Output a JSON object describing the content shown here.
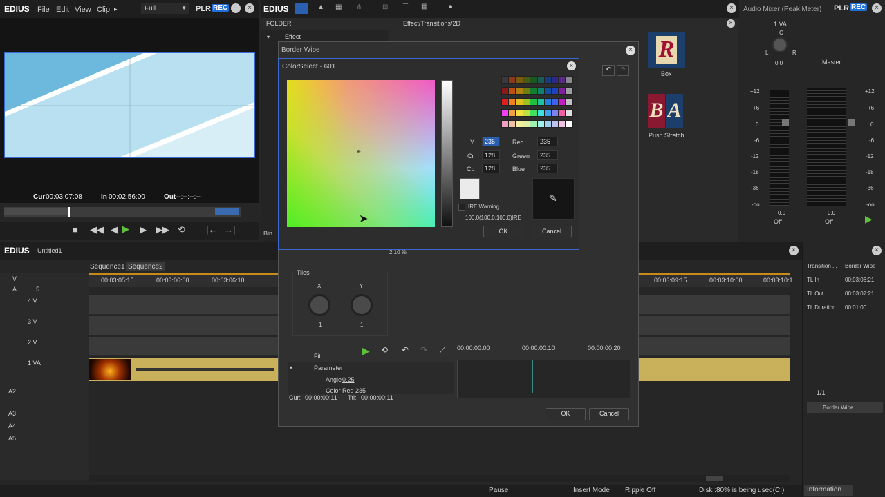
{
  "top_left": {
    "app": "EDIUS",
    "menus": [
      "File",
      "Edit",
      "View",
      "Clip"
    ],
    "quality": "Full",
    "plr": "PLR",
    "rec": "REC"
  },
  "top_mid": {
    "app": "EDIUS",
    "plr": "PLR",
    "rec": "REC"
  },
  "folder_panel": {
    "title": "FOLDER",
    "item": "Effect",
    "path": "Effect/Transitions/2D",
    "bin_label": "Bin"
  },
  "player": {
    "cur_label": "Cur",
    "cur": "00:03:07:08",
    "in_label": "In",
    "in": "00:02:56:00",
    "out_label": "Out",
    "out": "--:--:--:--"
  },
  "effects": [
    {
      "name": "Box"
    },
    {
      "name": "Push Stretch"
    }
  ],
  "mixer": {
    "title": "Audio Mixer (Peak Meter)",
    "channel": "1 VA",
    "master": "Master",
    "pan_c": "C",
    "pan_l": "L",
    "pan_r": "R",
    "val0": "0.0",
    "val_ch": "0.0",
    "val_master": "0.0",
    "off1": "Off",
    "off2": "Off",
    "scale": [
      "+12",
      "+6",
      "0",
      "-6",
      "-12",
      "-18",
      "-36",
      "-oo"
    ],
    "plr": "PLR",
    "rec": "REC"
  },
  "timeline": {
    "app": "EDIUS",
    "project": "Untitled1",
    "seq1": "Sequence1",
    "seq2": "Sequence2",
    "times": [
      "00:03:05:15",
      "00:03:06:00",
      "00:03:06:10",
      "00:03:09:15",
      "00:03:10:00",
      "00:03:10:1"
    ],
    "tracks": [
      "V",
      "A",
      "4 V",
      "3 V",
      "2 V",
      "1 VA"
    ],
    "a5": "5 ...",
    "audio_tracks": [
      "A2",
      "A3",
      "A4",
      "A5"
    ]
  },
  "info_panel": {
    "rows": [
      {
        "k": "Transition ...",
        "v": "Border Wipe"
      },
      {
        "k": "TL In",
        "v": "00:03:06:21"
      },
      {
        "k": "TL Out",
        "v": "00:03:07:21"
      },
      {
        "k": "TL Duration",
        "v": "00:01:00"
      }
    ],
    "count": "1/1",
    "item": "Border Wipe",
    "tab": "Information"
  },
  "status_bar": {
    "pause": "Pause",
    "insert": "Insert Mode",
    "ripple": "Ripple Off",
    "disk": "Disk :80% is being used(C:)"
  },
  "border_wipe": {
    "title": "Border Wipe",
    "tiles_label": "Tiles",
    "x_label": "X",
    "y_label": "Y",
    "x_val": "1",
    "y_val": "1",
    "percent": "2.10 %",
    "fit": "Fit",
    "t0": "00:00:00:00",
    "t1": "00:00:00:10",
    "t2": "00:00:00:20",
    "param": "Parameter",
    "angle_label": "Angle",
    "angle_val": "0.25",
    "color_red": "Color Red 235",
    "cur_label": "Cur:",
    "cur": "00:00:00:11",
    "ttl_label": "Ttl:",
    "ttl": "00:00:00:11",
    "ok": "OK",
    "cancel": "Cancel"
  },
  "color_select": {
    "title": "ColorSelect - 601",
    "y_label": "Y",
    "y": "235",
    "cr_label": "Cr",
    "cr": "128",
    "cb_label": "Cb",
    "cb": "128",
    "red_label": "Red",
    "red": "235",
    "green_label": "Green",
    "green": "235",
    "blue_label": "Blue",
    "blue": "235",
    "ire_warning": "IRE Warning",
    "ire_value": "100.0(100.0,100.0)IRE",
    "ok": "OK",
    "cancel": "Cancel",
    "preview_color": "#ebebeb"
  },
  "palette": [
    "#3a3a3a",
    "#8a3a1a",
    "#7a5a10",
    "#4a5a10",
    "#1a5a20",
    "#1a5a5a",
    "#1a3a7a",
    "#2a2a8a",
    "#5a2a8a",
    "#8a8a8a",
    "#8a1a1a",
    "#c05010",
    "#b08010",
    "#708010",
    "#108030",
    "#108070",
    "#1050a0",
    "#2040c0",
    "#8020a0",
    "#a0a0a0",
    "#e02020",
    "#f08020",
    "#e0c020",
    "#a0c020",
    "#20c040",
    "#20c0a0",
    "#2080e0",
    "#4060f0",
    "#c020c0",
    "#c0c0c0",
    "#f040f0",
    "#f0a040",
    "#f0e040",
    "#c0e040",
    "#40e060",
    "#40e0e0",
    "#40a0f0",
    "#8080f0",
    "#f060a0",
    "#e0e0e0",
    "#f0a0c0",
    "#f0c0a0",
    "#f0f0a0",
    "#e0f0a0",
    "#a0f0b0",
    "#a0f0f0",
    "#a0d0f0",
    "#c0c0f0",
    "#f0c0e0",
    "#ffffff"
  ]
}
